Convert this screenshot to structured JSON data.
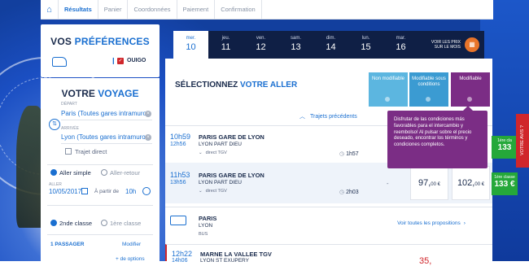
{
  "nav": {
    "steps": [
      "Résultats",
      "Panier",
      "Coordonnées",
      "Paiement",
      "Confirmation"
    ]
  },
  "prefs": {
    "title_a": "VOS ",
    "title_b": "PRÉFÉRENCES",
    "ouigo": "OUIGO"
  },
  "voyage": {
    "title_a": "VOTRE ",
    "title_b": "VOYAGE",
    "depart_label": "DÉPART",
    "depart_value": "Paris (Toutes gares intramuros)",
    "arrivee_label": "ARRIVÉE",
    "arrivee_value": "Lyon (Toutes gares intramuros)",
    "direct": "Trajet direct",
    "aller_simple": "Aller simple",
    "aller_retour": "Aller-retour",
    "aller_label": "ALLER",
    "aller_date": "10/05/2017",
    "a_partir": "À partir de",
    "heure": "10h",
    "classe2": "2nde classe",
    "classe1": "1ère classe",
    "passager": "1 PASSAGER",
    "modifier": "Modifier",
    "options": "+ de options"
  },
  "dates": [
    {
      "day": "mer.",
      "num": "10"
    },
    {
      "day": "jeu.",
      "num": "11"
    },
    {
      "day": "ven.",
      "num": "12"
    },
    {
      "day": "sam.",
      "num": "13"
    },
    {
      "day": "dim.",
      "num": "14"
    },
    {
      "day": "lun.",
      "num": "15"
    },
    {
      "day": "mar.",
      "num": "16"
    }
  ],
  "voir_prix": "VOIR LES PRIX SUR LE MOIS",
  "results": {
    "title_a": "SÉLECTIONNEZ ",
    "title_b": "VOTRE ALLER",
    "prev": "Trajets précédents",
    "tag1": "Non modifiable",
    "tag2": "Modifiable sous conditions",
    "tag3": "Modifiable",
    "tooltip": "Disfrutar de las condiciones más favorables para el intercambio y reembolso! Al pulsar sobre el precio deseado, encontrar los términos y condiciones completos.",
    "rows": [
      {
        "t1": "10h59",
        "t2": "12h56",
        "s1": "PARIS GARE DE LYON",
        "s2": "LYON PART DIEU",
        "dir": "direct TGV",
        "dur": "1h57"
      },
      {
        "t1": "11h53",
        "t2": "13h56",
        "s1": "PARIS GARE DE LYON",
        "s2": "LYON PART DIEU",
        "dir": "direct TGV",
        "dur": "2h03",
        "dash": "-",
        "p1": "97,",
        "p2": "102,",
        "cur": "00 €"
      },
      {
        "s1": "PARIS",
        "s2": "LYON",
        "dir": "BUS",
        "all": "Voir toutes les propositions"
      },
      {
        "t1": "12h22",
        "t2": "14h06",
        "s1": "MARNE LA VALLEE TGV",
        "s2": "LYON ST EXUPERY",
        "p": "35,"
      }
    ]
  },
  "side": {
    "p1_lbl": "1ère cla",
    "p1": "133",
    "p2_lbl": "1ère classe",
    "p2": "133 €",
    "vert": "VOTRE AVIS ?"
  }
}
